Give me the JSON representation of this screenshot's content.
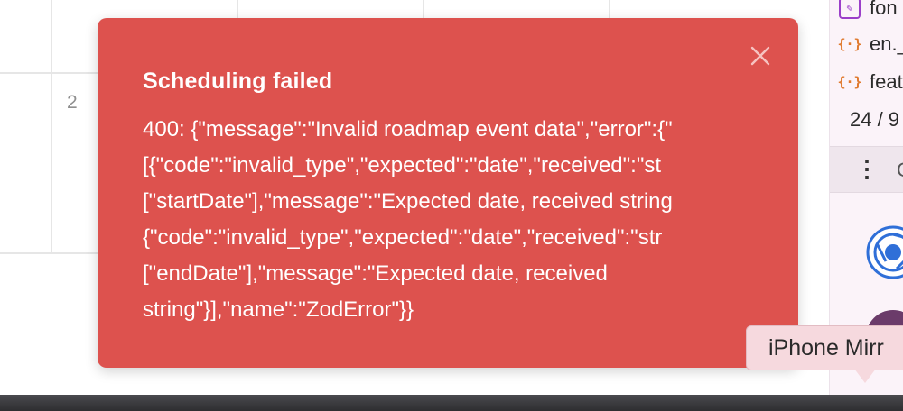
{
  "calendar": {
    "row_number": "2"
  },
  "side_panel": {
    "files": [
      {
        "icon": "edit-doc-icon",
        "name": "fon"
      },
      {
        "icon": "json-braces-icon",
        "name": "en._"
      },
      {
        "icon": "json-braces-icon",
        "name": "feat"
      }
    ],
    "counter": "24 / 9",
    "header_letter": "C"
  },
  "toast": {
    "title": "Scheduling failed",
    "lines": [
      "400: {\"message\":\"Invalid roadmap event data\",\"error\":{\"",
      "[{\"code\":\"invalid_type\",\"expected\":\"date\",\"received\":\"st",
      "[\"startDate\"],\"message\":\"Expected date, received string",
      "{\"code\":\"invalid_type\",\"expected\":\"date\",\"received\":\"str",
      "[\"endDate\"],\"message\":\"Expected date, received",
      "string\"}],\"name\":\"ZodError\"}}"
    ],
    "background": "#dd524e",
    "close_icon": "close-icon"
  },
  "tooltip": {
    "text": "iPhone Mirr"
  }
}
